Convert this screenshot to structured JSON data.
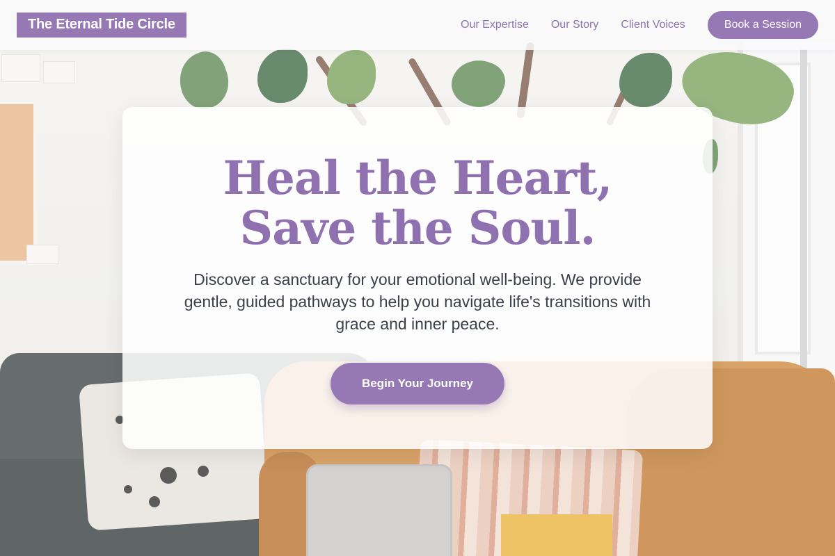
{
  "header": {
    "brand": "The Eternal Tide Circle",
    "nav": [
      {
        "label": "Our Expertise"
      },
      {
        "label": "Our Story"
      },
      {
        "label": "Client Voices"
      }
    ],
    "book_button": "Book a Session"
  },
  "hero": {
    "title": "Heal the Heart, Save the Soul.",
    "subtitle": "Discover a sanctuary for your emotional well-being. We provide gentle, guided pathways to help you navigate life's transitions with grace and inner peace.",
    "cta": "Begin Your Journey"
  },
  "theme": {
    "accent": "#9578b4",
    "title_color": "#9071b0",
    "text_color": "#3a3f4a"
  },
  "background": {
    "scene": "living room with fiddle-leaf fig plant, grey sofa, orange armchair, laptop"
  }
}
